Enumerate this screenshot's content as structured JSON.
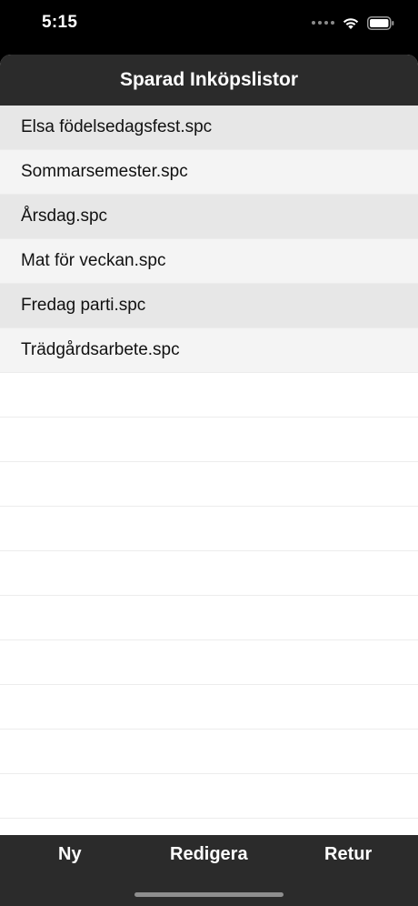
{
  "status_bar": {
    "time": "5:15",
    "icons": [
      "signal-icon",
      "wifi-icon",
      "battery-icon"
    ]
  },
  "nav": {
    "title": "Sparad Inköpslistor"
  },
  "list": {
    "items": [
      {
        "label": "Elsa födelsedagsfest.spc"
      },
      {
        "label": "Sommarsemester.spc"
      },
      {
        "label": "Årsdag.spc"
      },
      {
        "label": "Mat för veckan.spc"
      },
      {
        "label": "Fredag parti.spc"
      },
      {
        "label": "Trädgårdsarbete.spc"
      }
    ]
  },
  "toolbar": {
    "new_label": "Ny",
    "edit_label": "Redigera",
    "return_label": "Retur"
  },
  "colors": {
    "bar_background": "#2b2b2b",
    "row_shaded": "#e7e7e7",
    "row_light": "#f4f4f4"
  }
}
